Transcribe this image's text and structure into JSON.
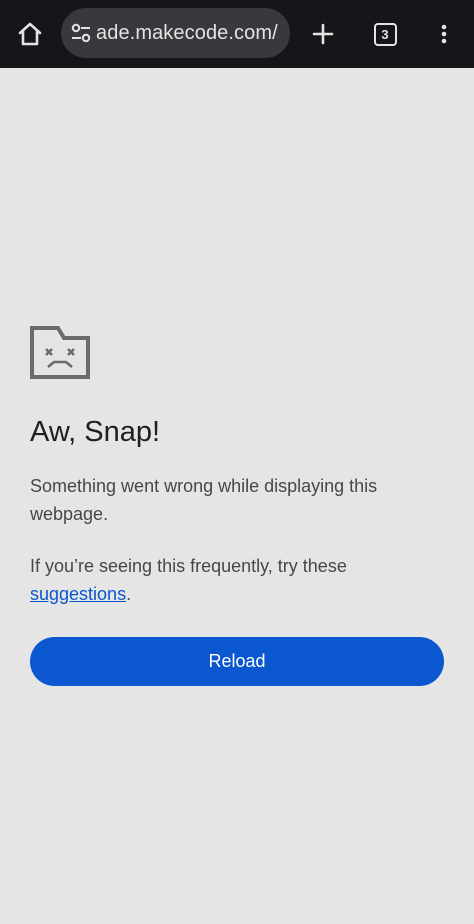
{
  "toolbar": {
    "url": "ade.makecode.com/",
    "tab_count": "3",
    "icons": {
      "home": "home-icon",
      "site_info": "tune-icon",
      "new_tab": "plus-icon",
      "menu": "more-vert-icon"
    }
  },
  "error": {
    "icon": "sad-tab-icon",
    "heading": "Aw, Snap!",
    "message": "Something went wrong while displaying this webpage.",
    "hint_prefix": "If you’re seeing this frequently, try these ",
    "hint_link": "suggestions",
    "hint_suffix": ".",
    "reload_label": "Reload"
  },
  "colors": {
    "toolbar_bg": "#151619",
    "page_bg": "#e5e5e5",
    "accent": "#0b57d0"
  }
}
